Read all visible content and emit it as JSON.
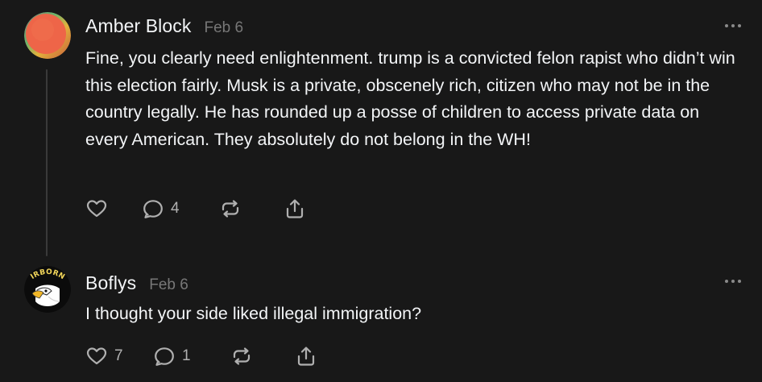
{
  "posts": [
    {
      "author": "Amber Block",
      "date": "Feb 6",
      "text": "Fine, you clearly need enlightenment. trump is a convicted felon rapist who didn’t win this election fairly. Musk is a private, obscenely rich, citizen who may not be in the country legally. He has rounded up a posse of children to access private data on every American. They absolutely do not belong in the WH!",
      "likes": "",
      "replies": "4",
      "avatar": "gradient-circle-avatar"
    },
    {
      "author": "Boflys",
      "date": "Feb 6",
      "text": "I thought your side liked illegal immigration?",
      "likes": "7",
      "replies": "1",
      "avatar_text": "AIRBORNE",
      "avatar": "airborne-eagle-avatar"
    }
  ],
  "icons": {
    "like": "heart-icon",
    "reply": "comment-icon",
    "repost": "repost-icon",
    "share": "share-icon",
    "more": "more-dots-icon"
  },
  "colors": {
    "background": "#181818",
    "primary_text": "#f3f5f7",
    "secondary_text": "#777777",
    "thread_line": "#3a3a3a"
  }
}
